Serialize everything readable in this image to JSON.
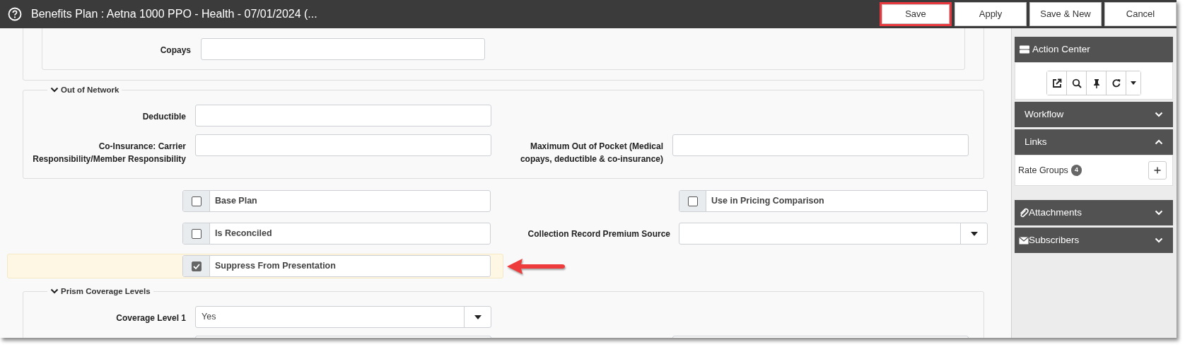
{
  "window": {
    "title": "Benefits Plan : Aetna 1000 PPO - Health - 07/01/2024 (..."
  },
  "buttons": [
    {
      "label": "Save",
      "highlighted": true
    },
    {
      "label": "Apply",
      "highlighted": false
    },
    {
      "label": "Save & New",
      "highlighted": false
    },
    {
      "label": "Cancel",
      "highlighted": false
    }
  ],
  "in_network": {
    "fields": [
      {
        "kind": "text",
        "label": "Copays"
      }
    ]
  },
  "out_of_network": {
    "title": "Out of Network",
    "expanded": true,
    "rows": [
      [
        {
          "kind": "text",
          "label": "Deductible"
        }
      ],
      [
        {
          "kind": "text",
          "label": "Co-Insurance: Carrier Responsibility/Member Responsibility"
        },
        {
          "kind": "text",
          "label": "Maximum Out of Pocket (Medical copays, deductible & co-insurance)"
        }
      ]
    ]
  },
  "options": [
    {
      "highlighted": false,
      "items": [
        {
          "kind": "checkbox",
          "label": "Base Plan",
          "checked": false
        },
        {
          "kind": "checkbox",
          "label": "Use in Pricing Comparison",
          "checked": false
        }
      ]
    },
    {
      "highlighted": false,
      "items": [
        {
          "kind": "checkbox",
          "label": "Is Reconciled",
          "checked": false
        },
        {
          "kind": "select",
          "label": "Collection Record Premium Source"
        }
      ]
    },
    {
      "highlighted": true,
      "items": [
        {
          "kind": "checkbox",
          "label": "Suppress From Presentation",
          "checked": true
        }
      ]
    }
  ],
  "prism": {
    "title": "Prism Coverage Levels",
    "expanded": true,
    "rows": [
      [
        {
          "kind": "select",
          "label": "Coverage Level 1",
          "value": "Yes"
        }
      ]
    ]
  },
  "sidebar": {
    "panels": [
      {
        "kind": "toolbar",
        "title": "Action Center"
      },
      {
        "kind": "section",
        "title": "Workflow",
        "expanded": false
      },
      {
        "kind": "section",
        "title": "Links",
        "expanded": true,
        "items": [
          {
            "label": "Rate Groups",
            "count": "4"
          }
        ]
      },
      {
        "kind": "attachments",
        "title": "Attachments",
        "expanded": false
      },
      {
        "kind": "subscribers",
        "title": "Subscribers",
        "expanded": false
      }
    ]
  }
}
